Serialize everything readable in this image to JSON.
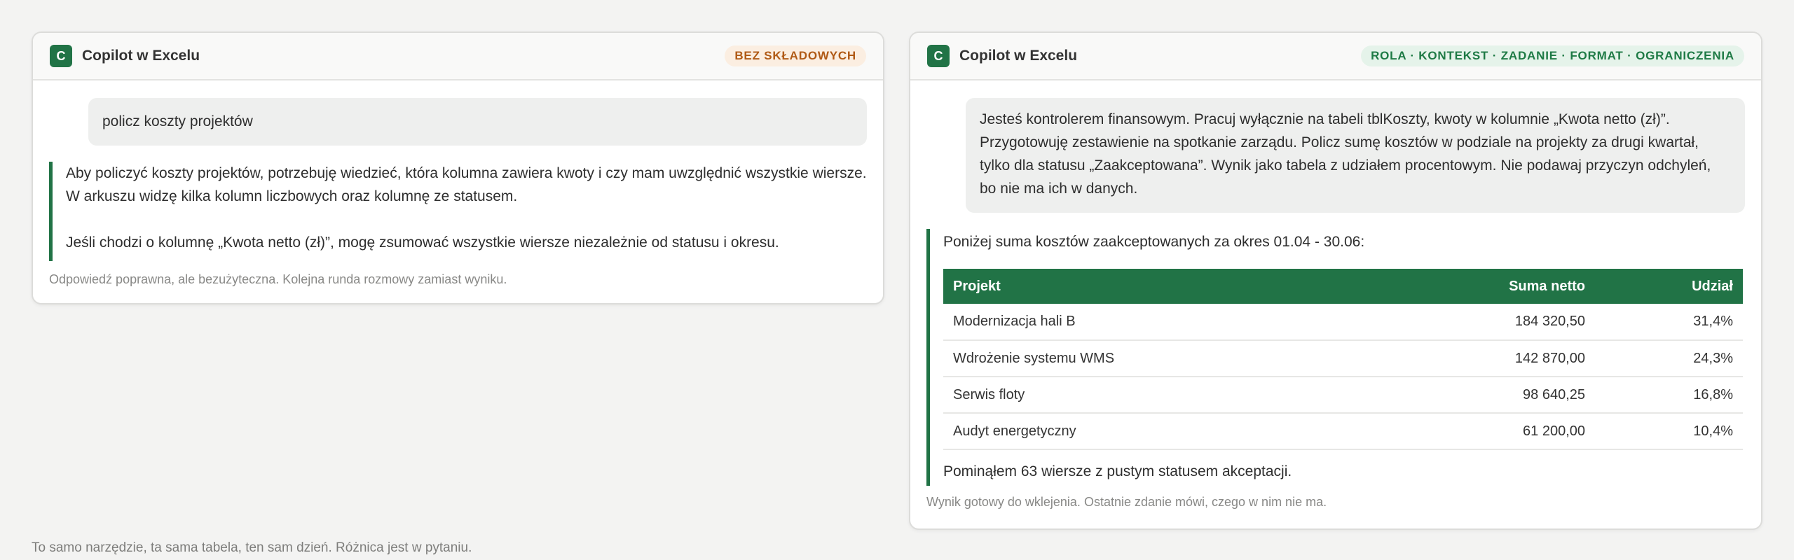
{
  "left_card": {
    "app_icon_letter": "C",
    "title": "Copilot w Excelu",
    "badge": "BEZ SKŁADOWYCH",
    "prompt": "policz koszty projektów",
    "response_p1": "Aby policzyć koszty projektów, potrzebuję wiedzieć, która kolumna zawiera kwoty i czy mam uwzględnić wszystkie wiersze. W arkuszu widzę kilka kolumn liczbowych oraz kolumnę ze statusem.",
    "response_p2": "Jeśli chodzi o kolumnę „Kwota netto (zł)”, mogę zsumować wszystkie wiersze niezależnie od statusu i okresu.",
    "caption": "Odpowiedź poprawna, ale bezużyteczna. Kolejna runda rozmowy zamiast wyniku."
  },
  "right_card": {
    "app_icon_letter": "C",
    "title": "Copilot w Excelu",
    "badge": "ROLA · KONTEKST · ZADANIE · FORMAT · OGRANICZENIA",
    "prompt": "Jesteś kontrolerem finansowym. Pracuj wyłącznie na tabeli tblKoszty, kwoty w kolumnie „Kwota netto (zł)”. Przygotowuję zestawienie na spotkanie zarządu. Policz sumę kosztów w podziale na projekty za drugi kwartał, tylko dla statusu „Zaakceptowana”. Wynik jako tabela z udziałem procentowym. Nie podawaj przyczyn odchyleń, bo nie ma ich w danych.",
    "response_intro": "Poniżej suma kosztów zaakceptowanych za okres 01.04 - 30.06:",
    "table": {
      "headers": [
        "Projekt",
        "Suma netto",
        "Udział"
      ],
      "rows": [
        [
          "Modernizacja hali B",
          "184 320,50",
          "31,4%"
        ],
        [
          "Wdrożenie systemu WMS",
          "142 870,00",
          "24,3%"
        ],
        [
          "Serwis floty",
          "98 640,25",
          "16,8%"
        ],
        [
          "Audyt energetyczny",
          "61 200,00",
          "10,4%"
        ]
      ]
    },
    "response_outro": "Pominąłem 63 wiersze z pustym statusem akceptacji.",
    "caption": "Wynik gotowy do wklejenia. Ostatnie zdanie mówi, czego w nim nie ma."
  },
  "footnote": "To samo narzędzie, ta sama tabela, ten sam dzień. Różnica jest w pytaniu.",
  "colors": {
    "excel_green": "#217346",
    "badge_orange_text": "#b05a16",
    "badge_orange_bg": "#fbeee1",
    "badge_green_text": "#1e7a45",
    "badge_green_bg": "#e5f3ea"
  }
}
